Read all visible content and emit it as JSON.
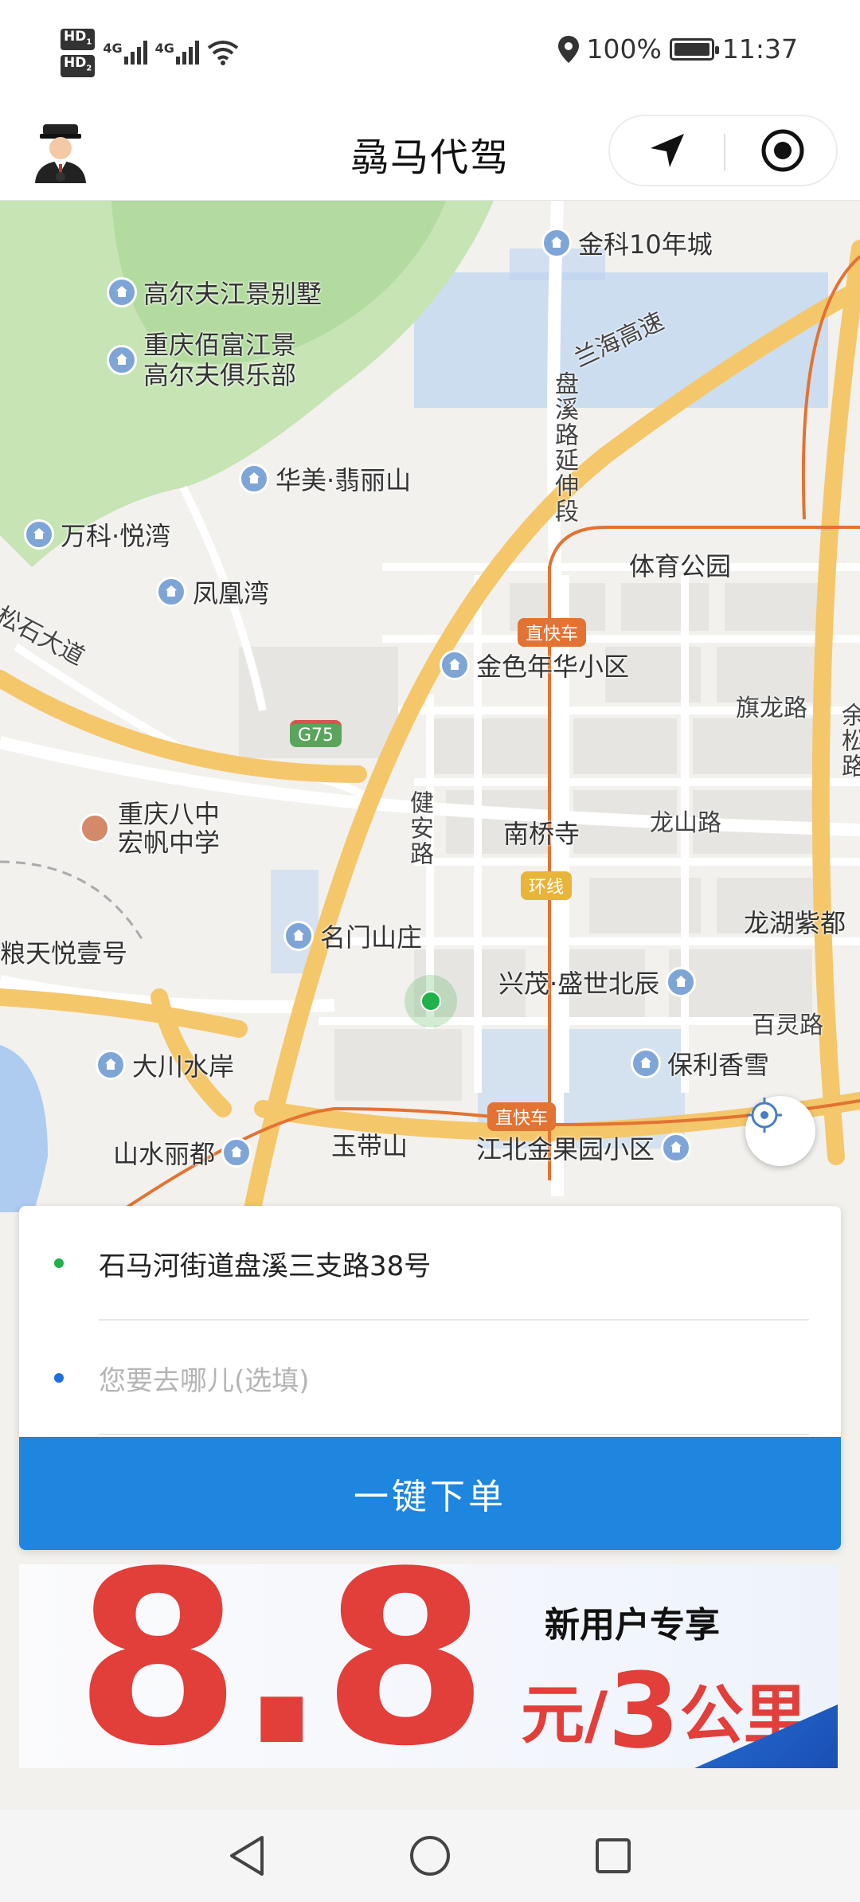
{
  "status_bar": {
    "hd1": "HD",
    "hd1_sub": "1",
    "hd2": "HD",
    "hd2_sub": "2",
    "net1": "4G",
    "net2": "4G",
    "battery": "100%",
    "time": "11:37"
  },
  "header": {
    "title": "骉马代驾",
    "avatar_icon": "driver-avatar-icon",
    "nav_icon": "navigation-arrow-icon",
    "target_icon": "record-target-icon"
  },
  "map": {
    "pois": [
      {
        "label": "金科10年城"
      },
      {
        "label": "高尔夫江景别墅"
      },
      {
        "label": "重庆佰富江景\n高尔夫俱乐部"
      },
      {
        "label": "华美·翡丽山"
      },
      {
        "label": "万科·悦湾"
      },
      {
        "label": "凤凰湾"
      },
      {
        "label": "金色年华小区"
      },
      {
        "label": "名门山庄"
      },
      {
        "label": "兴茂·盛世北辰"
      },
      {
        "label": "保利香雪"
      },
      {
        "label": "大川水岸"
      },
      {
        "label": "山水丽都"
      },
      {
        "label": "江北金果园小区"
      }
    ],
    "places": [
      {
        "label": "体育公园"
      },
      {
        "label": "南桥寺"
      },
      {
        "label": "玉带山"
      },
      {
        "label": "龙湖紫都"
      },
      {
        "label": "粮天悦壹号"
      },
      {
        "label": "重庆八中\n宏帆中学"
      }
    ],
    "roads": [
      {
        "label": "兰海高速"
      },
      {
        "label": "盘溪路延伸段"
      },
      {
        "label": "旗龙路"
      },
      {
        "label": "余松路"
      },
      {
        "label": "龙山路"
      },
      {
        "label": "健安路"
      },
      {
        "label": "百灵路"
      },
      {
        "label": "松石大道"
      }
    ],
    "badges": {
      "brt1": "直快车",
      "brt2": "直快车",
      "ring": "环线",
      "g75": "G75"
    },
    "colors": {
      "water": "#aecbf0",
      "green": "#c6e4b4",
      "highway": "#f5c76b",
      "metro": "#e27332"
    }
  },
  "order": {
    "pickup": "石马河街道盘溪三支路38号",
    "destination_placeholder": "您要去哪儿(选填)",
    "button": "一键下单",
    "pickup_dot_color": "#21b14b",
    "dest_dot_color": "#1e6fe0"
  },
  "promo": {
    "big_number": "8.8",
    "tag": "新用户专享",
    "price_unit": "元/",
    "price_num": "3",
    "price_suffix": "公里"
  },
  "navbar": {
    "back_icon": "back-triangle-icon",
    "home_icon": "home-circle-icon",
    "recents_icon": "recents-square-icon"
  }
}
